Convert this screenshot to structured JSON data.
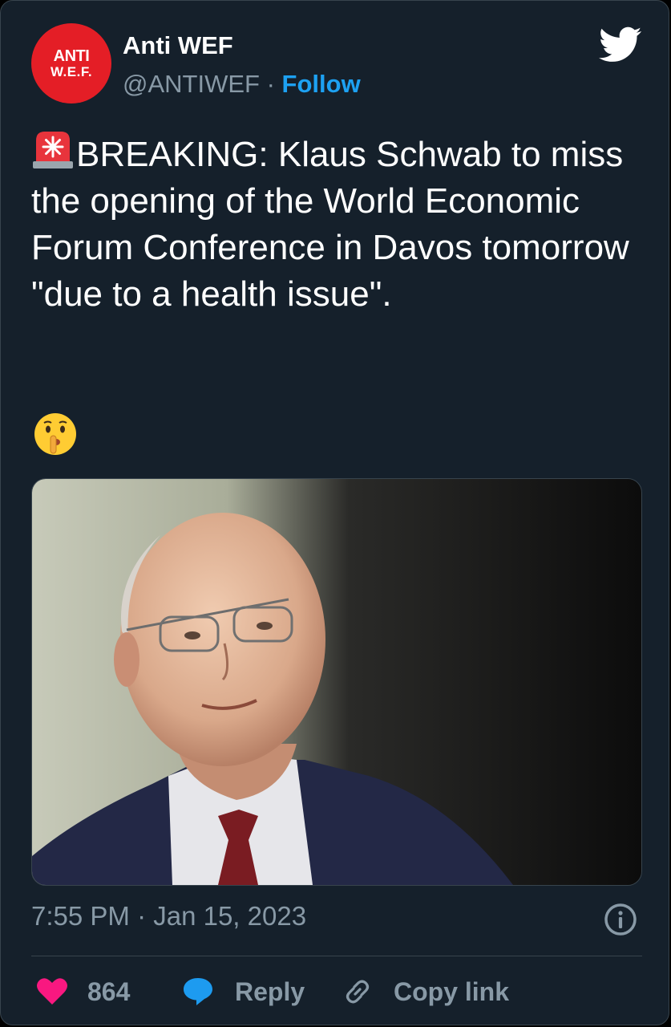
{
  "author": {
    "avatar_line1": "ANTI",
    "avatar_line2": "W.E.F.",
    "name": "Anti WEF",
    "handle": "@ANTIWEF",
    "separator": "·",
    "follow_label": "Follow"
  },
  "tweet": {
    "text": "BREAKING: Klaus Schwab to miss the opening of the World Economic Forum Conference in Davos tomorrow \"due to a health issue\".",
    "emoji_prefix": "police-car-light-icon",
    "emoji_suffix": "shushing-face-icon"
  },
  "timestamp": "7:55 PM · Jan 15, 2023",
  "actions": {
    "likes": "864",
    "reply_label": "Reply",
    "copy_label": "Copy link"
  },
  "colors": {
    "background": "#15202b",
    "border": "#38444d",
    "accent": "#1da1f2",
    "muted": "#8899a6",
    "like": "#f91880",
    "avatar": "#e41e26"
  }
}
